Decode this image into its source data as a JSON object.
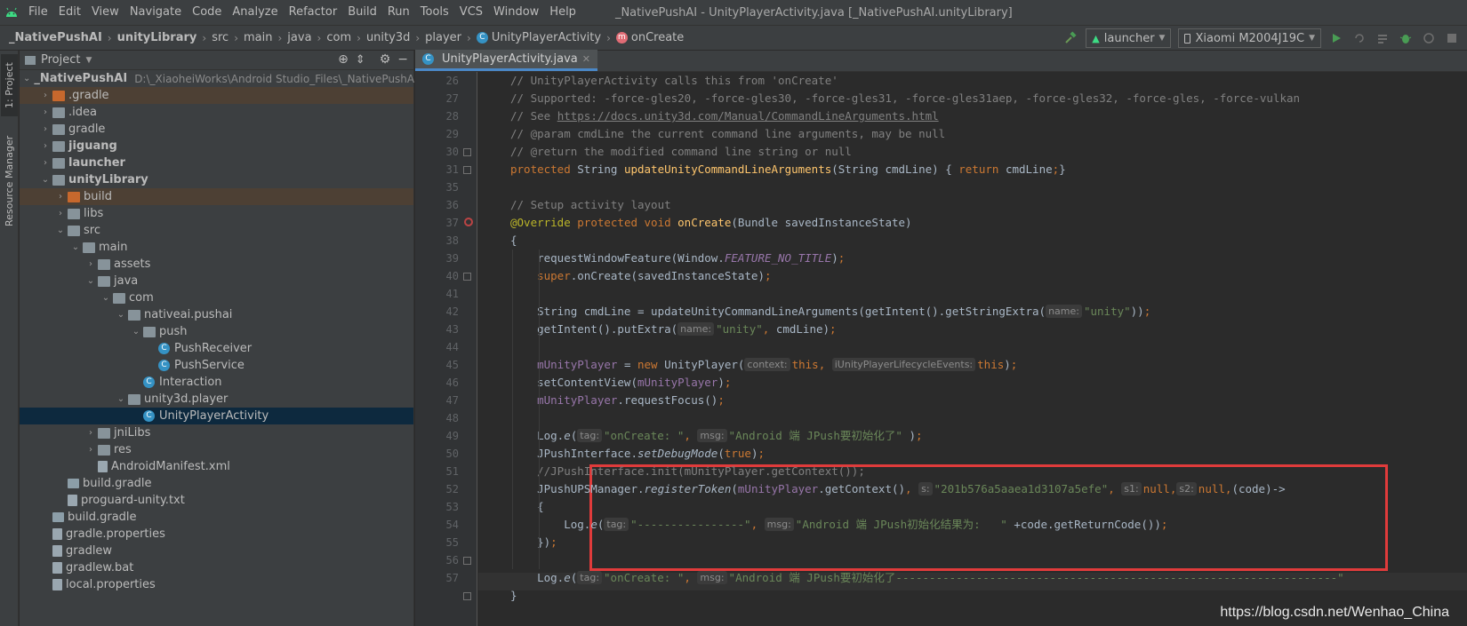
{
  "menu": {
    "items": [
      "File",
      "Edit",
      "View",
      "Navigate",
      "Code",
      "Analyze",
      "Refactor",
      "Build",
      "Run",
      "Tools",
      "VCS",
      "Window",
      "Help"
    ],
    "title": "_NativePushAI - UnityPlayerActivity.java [_NativePushAI.unityLibrary]"
  },
  "breadcrumb": [
    "_NativePushAI",
    "unityLibrary",
    "src",
    "main",
    "java",
    "com",
    "unity3d",
    "player",
    "UnityPlayerActivity",
    "onCreate"
  ],
  "run": {
    "config": "launcher",
    "device": "Xiaomi M2004J19C"
  },
  "stripe": {
    "project_tab": "1: Project",
    "resource_tab": "Resource Manager"
  },
  "project": {
    "title": "Project",
    "tree": [
      {
        "label": "_NativePushAI",
        "path": "D:\\_XiaoheiWorks\\Android Studio_Files\\_NativePushAI",
        "depth": 0,
        "open": true,
        "icon": "module",
        "bold": true
      },
      {
        "label": ".gradle",
        "depth": 1,
        "open": false,
        "icon": "orange-folder",
        "hl": true
      },
      {
        "label": ".idea",
        "depth": 1,
        "open": false,
        "icon": "folder"
      },
      {
        "label": "gradle",
        "depth": 1,
        "open": false,
        "icon": "folder"
      },
      {
        "label": "jiguang",
        "depth": 1,
        "open": false,
        "icon": "module",
        "bold": true
      },
      {
        "label": "launcher",
        "depth": 1,
        "open": false,
        "icon": "module",
        "bold": true
      },
      {
        "label": "unityLibrary",
        "depth": 1,
        "open": true,
        "icon": "module",
        "bold": true
      },
      {
        "label": "build",
        "depth": 2,
        "open": false,
        "icon": "orange-folder",
        "hl": true
      },
      {
        "label": "libs",
        "depth": 2,
        "open": false,
        "icon": "folder"
      },
      {
        "label": "src",
        "depth": 2,
        "open": true,
        "icon": "folder"
      },
      {
        "label": "main",
        "depth": 3,
        "open": true,
        "icon": "folder"
      },
      {
        "label": "assets",
        "depth": 4,
        "open": false,
        "icon": "folder"
      },
      {
        "label": "java",
        "depth": 4,
        "open": true,
        "icon": "folder"
      },
      {
        "label": "com",
        "depth": 5,
        "open": true,
        "icon": "folder"
      },
      {
        "label": "nativeai.pushai",
        "depth": 6,
        "open": true,
        "icon": "folder"
      },
      {
        "label": "push",
        "depth": 7,
        "open": true,
        "icon": "folder"
      },
      {
        "label": "PushReceiver",
        "depth": 8,
        "icon": "class"
      },
      {
        "label": "PushService",
        "depth": 8,
        "icon": "class"
      },
      {
        "label": "Interaction",
        "depth": 7,
        "icon": "class"
      },
      {
        "label": "unity3d.player",
        "depth": 6,
        "open": true,
        "icon": "folder"
      },
      {
        "label": "UnityPlayerActivity",
        "depth": 7,
        "icon": "class",
        "selected": true
      },
      {
        "label": "jniLibs",
        "depth": 4,
        "open": false,
        "icon": "folder"
      },
      {
        "label": "res",
        "depth": 4,
        "open": false,
        "icon": "folder"
      },
      {
        "label": "AndroidManifest.xml",
        "depth": 4,
        "icon": "file"
      },
      {
        "label": "build.gradle",
        "depth": 2,
        "icon": "gradle"
      },
      {
        "label": "proguard-unity.txt",
        "depth": 2,
        "icon": "file"
      },
      {
        "label": "build.gradle",
        "depth": 1,
        "icon": "gradle"
      },
      {
        "label": "gradle.properties",
        "depth": 1,
        "icon": "file"
      },
      {
        "label": "gradlew",
        "depth": 1,
        "icon": "file"
      },
      {
        "label": "gradlew.bat",
        "depth": 1,
        "icon": "file"
      },
      {
        "label": "local.properties",
        "depth": 1,
        "icon": "file"
      }
    ]
  },
  "editor": {
    "tab": "UnityPlayerActivity.java",
    "lines": [
      {
        "n": "26",
        "t": [
          [
            "cm",
            "// UnityPlayerActivity calls this from 'onCreate'"
          ]
        ]
      },
      {
        "n": "27",
        "t": [
          [
            "cm",
            "// Supported: -force-gles20, -force-gles30, -force-gles31, -force-gles31aep, -force-gles32, -force-gles, -force-vulkan"
          ]
        ]
      },
      {
        "n": "28",
        "t": [
          [
            "cm",
            "// See "
          ],
          [
            "cm ul",
            "https://docs.unity3d.com/Manual/CommandLineArguments.html"
          ]
        ]
      },
      {
        "n": "29",
        "t": [
          [
            "cm",
            "// @param cmdLine the current command line arguments, may be null"
          ]
        ]
      },
      {
        "n": "30",
        "t": [
          [
            "cm",
            "// @return the modified command line string or null"
          ]
        ]
      },
      {
        "n": "31",
        "t": [
          [
            "kw",
            "protected "
          ],
          [
            "",
            "String "
          ],
          [
            "fn",
            "updateUnityCommandLineArguments"
          ],
          [
            "",
            "(String cmdLine) "
          ],
          [
            "",
            "{ "
          ],
          [
            "kw",
            "return "
          ],
          [
            "",
            "cmdLine"
          ],
          [
            "kw",
            ";"
          ],
          [
            "",
            ""
          ],
          [
            "",
            ""
          ],
          [
            "",
            "}"
          ]
        ]
      },
      {
        "n": "35",
        "t": []
      },
      {
        "n": "36",
        "t": [
          [
            "cm",
            "// Setup activity layout"
          ]
        ]
      },
      {
        "n": "37",
        "t": [
          [
            "an",
            "@Override "
          ],
          [
            "kw",
            "protected void "
          ],
          [
            "fn",
            "onCreate"
          ],
          [
            "",
            "(Bundle savedInstanceState)"
          ]
        ]
      },
      {
        "n": "38",
        "t": [
          [
            "",
            "{"
          ]
        ]
      },
      {
        "n": "39",
        "t": [
          [
            "",
            "    requestWindowFeature(Window."
          ],
          [
            "fd it",
            "FEATURE_NO_TITLE"
          ],
          [
            "",
            ")"
          ],
          [
            "kw",
            ";"
          ]
        ]
      },
      {
        "n": "40",
        "t": [
          [
            "kw",
            "    super"
          ],
          [
            "",
            ".onCreate(savedInstanceState)"
          ],
          [
            "kw",
            ";"
          ]
        ]
      },
      {
        "n": "41",
        "t": []
      },
      {
        "n": "42",
        "t": [
          [
            "",
            "    String cmdLine = updateUnityCommandLineArguments(getIntent().getStringExtra("
          ],
          [
            "hint",
            "name:"
          ],
          [
            "st",
            "\"unity\""
          ],
          [
            "",
            "))"
          ],
          [
            "kw",
            ";"
          ]
        ]
      },
      {
        "n": "43",
        "t": [
          [
            "",
            "    getIntent().putExtra("
          ],
          [
            "hint",
            "name:"
          ],
          [
            "st",
            "\"unity\""
          ],
          [
            "kw",
            ", "
          ],
          [
            "",
            "cmdLine)"
          ],
          [
            "kw",
            ";"
          ]
        ]
      },
      {
        "n": "44",
        "t": []
      },
      {
        "n": "45",
        "t": [
          [
            "fd",
            "    mUnityPlayer "
          ],
          [
            "",
            "= "
          ],
          [
            "kw",
            "new "
          ],
          [
            "",
            "UnityPlayer("
          ],
          [
            "hint",
            "context:"
          ],
          [
            "kw",
            "this, "
          ],
          [
            "hint",
            "iUnityPlayerLifecycleEvents:"
          ],
          [
            "kw",
            "this"
          ],
          [
            "",
            ")"
          ],
          [
            "kw",
            ";"
          ]
        ]
      },
      {
        "n": "46",
        "t": [
          [
            "",
            "    setContentView("
          ],
          [
            "fd",
            "mUnityPlayer"
          ],
          [
            "",
            ")"
          ],
          [
            "kw",
            ";"
          ]
        ]
      },
      {
        "n": "47",
        "t": [
          [
            "fd",
            "    mUnityPlayer"
          ],
          [
            "",
            ".requestFocus()"
          ],
          [
            "kw",
            ";"
          ]
        ]
      },
      {
        "n": "48",
        "t": []
      },
      {
        "n": "49",
        "t": [
          [
            "",
            "    Log."
          ],
          [
            "it",
            "e"
          ],
          [
            "",
            "("
          ],
          [
            "hint",
            "tag:"
          ],
          [
            "st",
            "\"onCreate: \""
          ],
          [
            "kw",
            ", "
          ],
          [
            "hint",
            "msg:"
          ],
          [
            "st",
            "\"Android 端 JPush要初始化了\""
          ],
          [
            "",
            " )"
          ],
          [
            "kw",
            ";"
          ]
        ]
      },
      {
        "n": "50",
        "t": [
          [
            "",
            "    JPushInterface."
          ],
          [
            "it",
            "setDebugMode"
          ],
          [
            "",
            "("
          ],
          [
            "kw",
            "true"
          ],
          [
            "",
            ")"
          ],
          [
            "kw",
            ";"
          ]
        ]
      },
      {
        "n": "51",
        "t": [
          [
            "cm",
            "    //JPushInterface.init(mUnityPlayer.getContext());"
          ]
        ]
      },
      {
        "n": "52",
        "t": [
          [
            "",
            "    JPushUPSManager."
          ],
          [
            "it",
            "registerToken"
          ],
          [
            "",
            "("
          ],
          [
            "fd",
            "mUnityPlayer"
          ],
          [
            "",
            ".getContext()"
          ],
          [
            "kw",
            ", "
          ],
          [
            "hint",
            "s:"
          ],
          [
            "st",
            "\"201b576a5aaea1d3107a5efe\""
          ],
          [
            "kw",
            ", "
          ],
          [
            "hint",
            "s1:"
          ],
          [
            "kw",
            "null,"
          ],
          [
            "hint",
            "s2:"
          ],
          [
            "kw",
            "null,"
          ],
          [
            "",
            "(code)->"
          ]
        ]
      },
      {
        "n": "53",
        "t": [
          [
            "",
            "    {"
          ]
        ]
      },
      {
        "n": "54",
        "t": [
          [
            "",
            "        Log."
          ],
          [
            "it",
            "e"
          ],
          [
            "",
            "("
          ],
          [
            "hint",
            "tag:"
          ],
          [
            "st",
            "\"----------------\""
          ],
          [
            "kw",
            ", "
          ],
          [
            "hint",
            "msg:"
          ],
          [
            "st",
            "\"Android 端 JPush初始化结果为:   \""
          ],
          [
            "",
            " +code.getReturnCode())"
          ],
          [
            "kw",
            ";"
          ]
        ]
      },
      {
        "n": "55",
        "t": [
          [
            "",
            "    })"
          ],
          [
            "kw",
            ";"
          ]
        ]
      },
      {
        "n": "56",
        "t": []
      },
      {
        "n": "57",
        "t": [
          [
            "",
            "    Log."
          ],
          [
            "it",
            "e"
          ],
          [
            "",
            "("
          ],
          [
            "hint",
            "tag:"
          ],
          [
            "st",
            "\"onCreate: \""
          ],
          [
            "kw",
            ", "
          ],
          [
            "hint",
            "msg:"
          ],
          [
            "st",
            "\"Android 端 JPush要初始化了------------------------------------------------------------------\""
          ]
        ]
      },
      {
        "n": "",
        "t": [
          [
            "",
            "}"
          ]
        ]
      }
    ]
  },
  "watermark": "https://blog.csdn.net/Wenhao_China"
}
